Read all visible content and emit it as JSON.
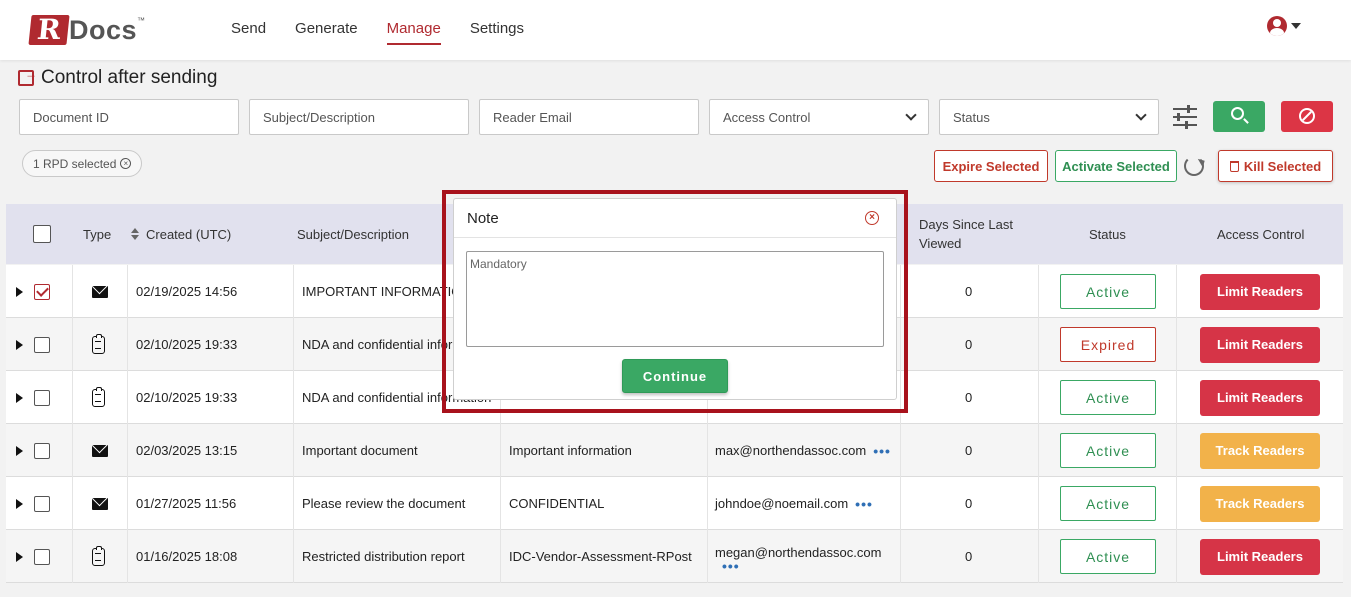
{
  "app": {
    "logo_r": "R",
    "logo_docs": "Docs",
    "logo_tm": "™"
  },
  "nav": {
    "items": [
      {
        "label": "Send",
        "active": false
      },
      {
        "label": "Generate",
        "active": false
      },
      {
        "label": "Manage",
        "active": true
      },
      {
        "label": "Settings",
        "active": false
      }
    ]
  },
  "page": {
    "title": "Control after sending"
  },
  "filters": {
    "document_id": "Document ID",
    "subject": "Subject/Description",
    "reader_email": "Reader Email",
    "access_control": "Access Control",
    "status": "Status"
  },
  "selection": {
    "chip_label": "1 RPD selected"
  },
  "actions": {
    "expire": "Expire Selected",
    "activate": "Activate Selected",
    "kill": "Kill Selected"
  },
  "table": {
    "headers": {
      "type": "Type",
      "created": "Created (UTC)",
      "subject": "Subject/Description",
      "days_line1": "Days Since Last",
      "days_line2": "Viewed",
      "status": "Status",
      "access": "Access Control"
    },
    "rows": [
      {
        "checked": true,
        "icon": "envelope-icon",
        "created": "02/19/2025 14:56",
        "subject": "IMPORTANT INFORMATION",
        "description": "",
        "email": "",
        "dots": false,
        "days": "0",
        "status": "Active",
        "status_kind": "active",
        "access": "Limit Readers",
        "access_kind": "limit"
      },
      {
        "checked": false,
        "icon": "clipboard-icon",
        "created": "02/10/2025 19:33",
        "subject": "NDA and confidential information",
        "description": "",
        "email": "",
        "dots": false,
        "days": "0",
        "status": "Expired",
        "status_kind": "expired",
        "access": "Limit Readers",
        "access_kind": "limit"
      },
      {
        "checked": false,
        "icon": "clipboard-icon",
        "created": "02/10/2025 19:33",
        "subject": "NDA and confidential information",
        "description": "",
        "email": "",
        "dots": false,
        "days": "0",
        "status": "Active",
        "status_kind": "active",
        "access": "Limit Readers",
        "access_kind": "limit"
      },
      {
        "checked": false,
        "icon": "envelope-icon",
        "created": "02/03/2025 13:15",
        "subject": "Important document",
        "description": "Important information",
        "email": "max@northendassoc.com",
        "dots": true,
        "days": "0",
        "status": "Active",
        "status_kind": "active",
        "access": "Track Readers",
        "access_kind": "track"
      },
      {
        "checked": false,
        "icon": "envelope-icon",
        "created": "01/27/2025 11:56",
        "subject": "Please review the document",
        "description": "CONFIDENTIAL",
        "email": "johndoe@noemail.com",
        "dots": true,
        "days": "0",
        "status": "Active",
        "status_kind": "active",
        "access": "Track Readers",
        "access_kind": "track"
      },
      {
        "checked": false,
        "icon": "clipboard-icon",
        "created": "01/16/2025 18:08",
        "subject": "Restricted distribution report",
        "description": "IDC-Vendor-Assessment-RPost",
        "email": "megan@northendassoc.com",
        "dots": true,
        "dots_below": true,
        "days": "0",
        "status": "Active",
        "status_kind": "active",
        "access": "Limit Readers",
        "access_kind": "limit"
      }
    ]
  },
  "modal": {
    "title": "Note",
    "placeholder": "Mandatory",
    "continue_label": "Continue"
  },
  "colors": {
    "brand": "#b02a30",
    "success": "#3aa864",
    "danger": "#d63447",
    "warning": "#f2b24a"
  }
}
